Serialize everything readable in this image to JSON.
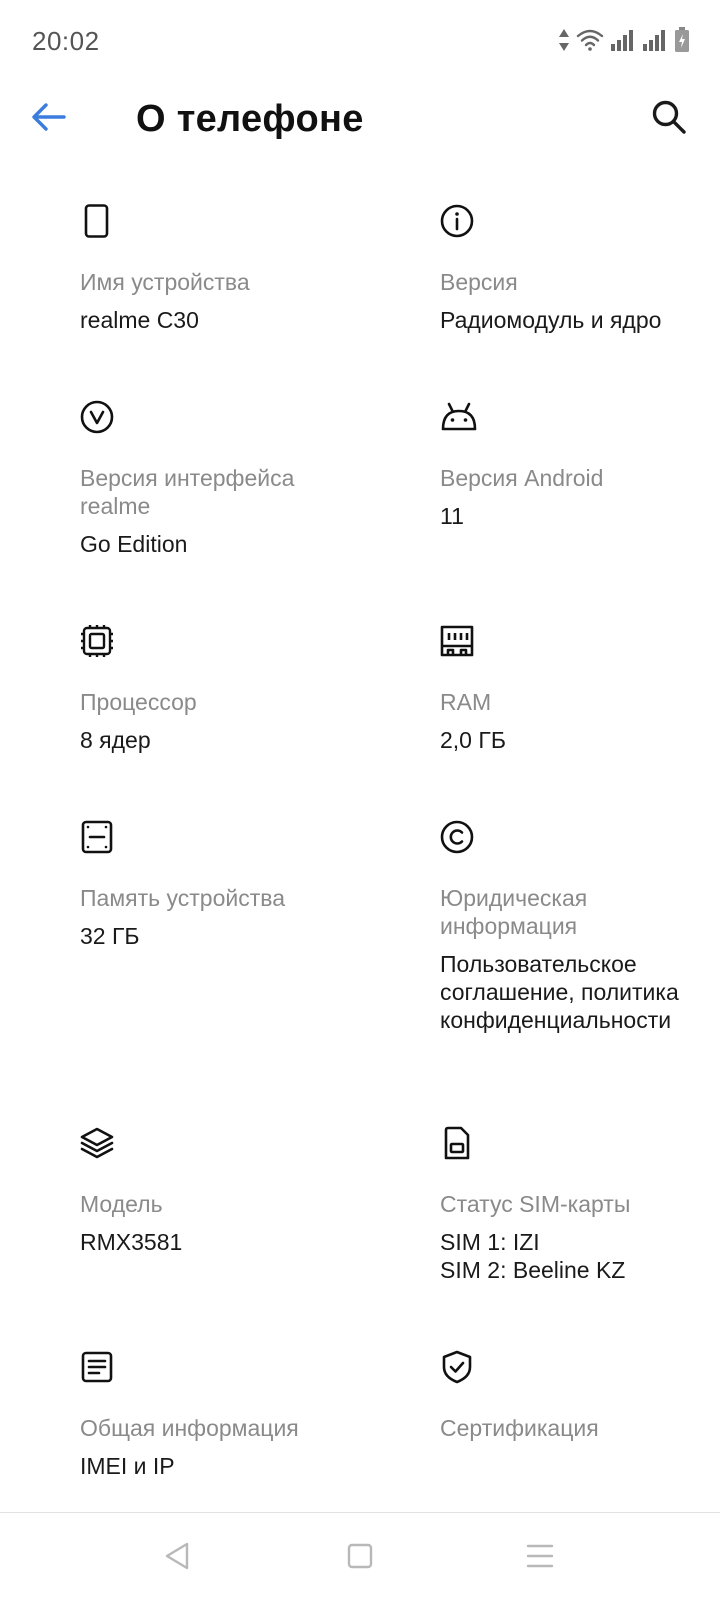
{
  "status_bar": {
    "time": "20:02",
    "icons": [
      "data-arrows-icon",
      "wifi-icon",
      "signal-icon",
      "signal-icon",
      "battery-icon"
    ]
  },
  "app_bar": {
    "title": "О телефоне",
    "back_icon": "arrow-left-icon",
    "search_icon": "search-icon",
    "accent_color": "#3b7ddd"
  },
  "items": [
    {
      "icon": "phone-icon",
      "label": "Имя устройства",
      "value": "realme C30"
    },
    {
      "icon": "info-icon",
      "label": "Версия",
      "value": "Радиомодуль и ядро"
    },
    {
      "icon": "version-icon",
      "label": "Версия интерфейса realme",
      "value": "Go Edition"
    },
    {
      "icon": "android-icon",
      "label": "Версия Android",
      "value": "11"
    },
    {
      "icon": "processor-icon",
      "label": "Процессор",
      "value": "8 ядер"
    },
    {
      "icon": "ram-icon",
      "label": "RAM",
      "value": "2,0 ГБ"
    },
    {
      "icon": "storage-icon",
      "label": "Память устройства",
      "value": "32 ГБ"
    },
    {
      "icon": "copyright-icon",
      "label": "Юридическая информация",
      "value": "Пользовательское соглашение, политика конфиденциальности"
    },
    {
      "icon": "layers-icon",
      "label": "Модель",
      "value": "RMX3581"
    },
    {
      "icon": "sim-card-icon",
      "label": "Статус SIM-карты",
      "value": "SIM 1: IZI\nSIM 2: Beeline KZ"
    },
    {
      "icon": "document-icon",
      "label": "Общая информация",
      "value": "IMEI и IP"
    },
    {
      "icon": "shield-check-icon",
      "label": "Сертификация",
      "value": ""
    }
  ],
  "nav_bar": {
    "icons": [
      "triangle-back-icon",
      "square-home-icon",
      "menu-recents-icon"
    ]
  }
}
